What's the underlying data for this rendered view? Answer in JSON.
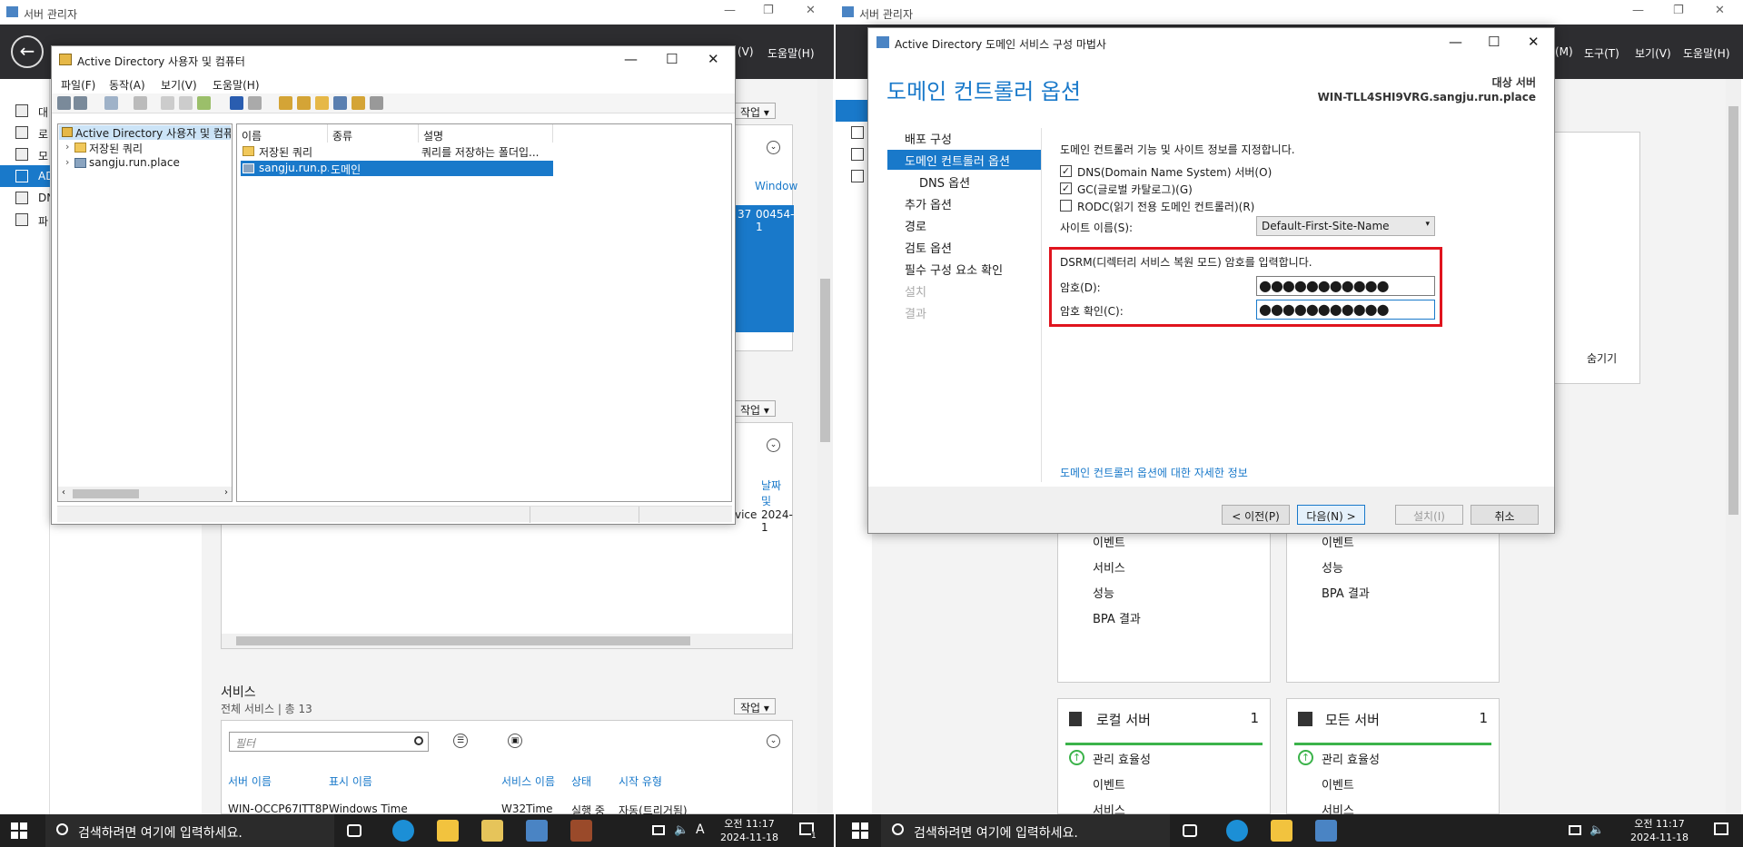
{
  "left_server_manager": {
    "title": "서버 관리자",
    "menu_help": "도움말(H)",
    "menu_view_partial": "(V)",
    "nav_items": [
      "대",
      "로",
      "모",
      "AD",
      "DN",
      "파"
    ],
    "action_label_1": "작업",
    "action_label_2": "작업",
    "action_label_3": "작업",
    "windows_partial": "Window",
    "row_partial_1": "37",
    "row_partial_2": "00454-1",
    "date_header_partial": "날짜 및",
    "row_partial_3": "vice",
    "row_partial_4": "2024-1",
    "services_title": "서비스",
    "services_subtitle": "전체 서비스 | 총 13",
    "services_filter_placeholder": "필터",
    "services_columns": [
      "서버 이름",
      "표시 이름",
      "서비스 이름",
      "상태",
      "시작 유형"
    ],
    "services_row": [
      "WIN-OCCP67ITT8P",
      "Windows Time",
      "W32Time",
      "실행 중",
      "자동(트리거됨)"
    ]
  },
  "aduc": {
    "title": "Active Directory 사용자 및 컴퓨터",
    "menu": [
      "파일(F)",
      "동작(A)",
      "보기(V)",
      "도움말(H)"
    ],
    "tree": [
      "Active Directory 사용자 및 컴퓨",
      "저장된 쿼리",
      "sangju.run.place"
    ],
    "columns": [
      "이름",
      "종류",
      "설명"
    ],
    "rows": [
      {
        "name": "저장된 쿼리",
        "type": "",
        "desc": "쿼리를 저장하는 폴더입..."
      },
      {
        "name": "sangju.run.p...",
        "type": "도메인",
        "desc": ""
      }
    ]
  },
  "right_server_manager": {
    "title": "서버 관리자",
    "menu": [
      "(M)",
      "도구(T)",
      "보기(V)",
      "도움말(H)"
    ],
    "hide_label": "숨기기",
    "tile_top_left_items": [
      "이벤트",
      "서비스",
      "성능",
      "BPA 결과"
    ],
    "tile_top_right_items": [
      "이벤트",
      "성능",
      "BPA 결과"
    ],
    "tile_local": {
      "title": "로컬 서버",
      "count": "1",
      "items": [
        "관리 효율성",
        "이벤트",
        "서비스"
      ]
    },
    "tile_all": {
      "title": "모든 서버",
      "count": "1",
      "items": [
        "관리 효율성",
        "이벤트",
        "서비스"
      ]
    }
  },
  "wizard": {
    "title": "Active Directory 도메인 서비스 구성 마법사",
    "heading": "도메인 컨트롤러 옵션",
    "target_label": "대상 서버",
    "target_server": "WIN-TLL4SHI9VRG.sangju.run.place",
    "steps": [
      "배포 구성",
      "도메인 컨트롤러 옵션",
      "DNS 옵션",
      "추가 옵션",
      "경로",
      "검토 옵션",
      "필수 구성 요소 확인",
      "설치",
      "결과"
    ],
    "intro": "도메인 컨트롤러 기능 및 사이트 정보를 지정합니다.",
    "checkbox_dns": "DNS(Domain Name System) 서버(O)",
    "checkbox_gc": "GC(글로벌 카탈로그)(G)",
    "checkbox_rodc": "RODC(읽기 전용 도메인 컨트롤러)(R)",
    "site_label": "사이트 이름(S):",
    "site_value": "Default-First-Site-Name",
    "dsrm_text": "DSRM(디렉터리 서비스 복원 모드) 암호를 입력합니다.",
    "password_label": "암호(D):",
    "confirm_label": "암호 확인(C):",
    "password_value": "●●●●●●●●●●●",
    "confirm_value": "●●●●●●●●●●●",
    "more_info_link": "도메인 컨트롤러 옵션에 대한 자세한 정보",
    "buttons": {
      "prev": "< 이전(P)",
      "next": "다음(N) >",
      "install": "설치(I)",
      "cancel": "취소"
    }
  },
  "taskbar_left": {
    "search_placeholder": "검색하려면 여기에 입력하세요.",
    "time": "오전 11:17",
    "date": "2024-11-18",
    "ime": "A",
    "notif": "1"
  },
  "taskbar_right": {
    "search_placeholder": "검색하려면 여기에 입력하세요.",
    "time": "오전 11:17",
    "date": "2024-11-18"
  },
  "colors": {
    "accent": "#1979ca",
    "highlight_box": "#e0141e",
    "dark_header": "#2d2d30",
    "taskbar": "#1f1f1f"
  }
}
